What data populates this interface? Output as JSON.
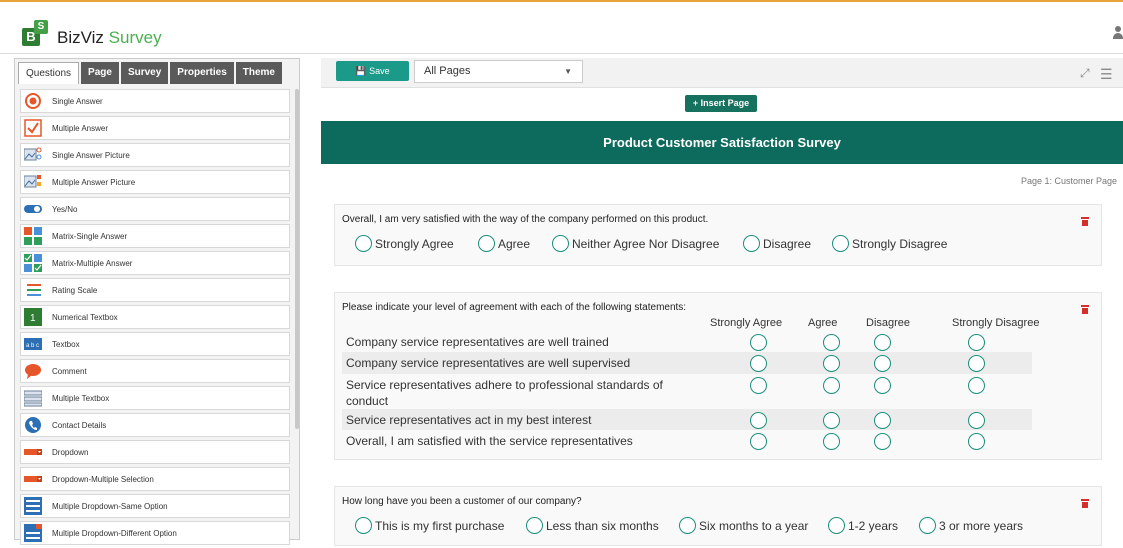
{
  "brand": {
    "name_part1": "BizViz",
    "name_part2": " Survey",
    "logo_b": "B",
    "logo_s": "S"
  },
  "tabs": [
    "Questions",
    "Page",
    "Survey",
    "Properties",
    "Theme"
  ],
  "question_types": [
    {
      "label": "Single Answer",
      "icon": "single-answer-icon"
    },
    {
      "label": "Multiple Answer",
      "icon": "multiple-answer-icon"
    },
    {
      "label": "Single Answer Picture",
      "icon": "single-answer-picture-icon"
    },
    {
      "label": "Multiple Answer Picture",
      "icon": "multiple-answer-picture-icon"
    },
    {
      "label": "Yes/No",
      "icon": "yes-no-icon"
    },
    {
      "label": "Matrix-Single Answer",
      "icon": "matrix-single-icon"
    },
    {
      "label": "Matrix-Multiple Answer",
      "icon": "matrix-multiple-icon"
    },
    {
      "label": "Rating Scale",
      "icon": "rating-scale-icon"
    },
    {
      "label": "Numerical Textbox",
      "icon": "numerical-textbox-icon"
    },
    {
      "label": "Textbox",
      "icon": "textbox-icon"
    },
    {
      "label": "Comment",
      "icon": "comment-icon"
    },
    {
      "label": "Multiple Textbox",
      "icon": "multiple-textbox-icon"
    },
    {
      "label": "Contact Details",
      "icon": "contact-details-icon"
    },
    {
      "label": "Dropdown",
      "icon": "dropdown-icon"
    },
    {
      "label": "Dropdown-Multiple Selection",
      "icon": "dropdown-multiple-icon"
    },
    {
      "label": "Multiple Dropdown-Same Option",
      "icon": "multi-dropdown-same-icon"
    },
    {
      "label": "Multiple Dropdown-Different Option",
      "icon": "multi-dropdown-diff-icon"
    }
  ],
  "toolbar": {
    "save_label": "Save",
    "page_select": "All Pages",
    "insert_page": "Insert Page"
  },
  "survey": {
    "title": "Product Customer Satisfaction Survey",
    "page_label": "Page 1:  Customer Page",
    "q1": {
      "text": "Overall, I am very satisfied with the way of the company performed on this product.",
      "options": [
        "Strongly Agree",
        "Agree",
        "Neither Agree Nor Disagree",
        "Disagree",
        "Strongly Disagree"
      ]
    },
    "q2": {
      "text": "Please indicate your level of agreement with each of the following statements:",
      "columns": [
        "Strongly Agree",
        "Agree",
        "Disagree",
        "Strongly Disagree"
      ],
      "rows": [
        "Company service representatives are well trained",
        "Company service representatives are well supervised",
        "Service representatives adhere to professional standards of conduct",
        "Service representatives act in my best interest",
        "Overall, I am satisfied with the service representatives"
      ]
    },
    "q3": {
      "text": "How long have you been a customer of our company?",
      "options": [
        "This is my first purchase",
        "Less than six months",
        "Six months to a year",
        "1-2 years",
        "3 or more years"
      ]
    }
  }
}
